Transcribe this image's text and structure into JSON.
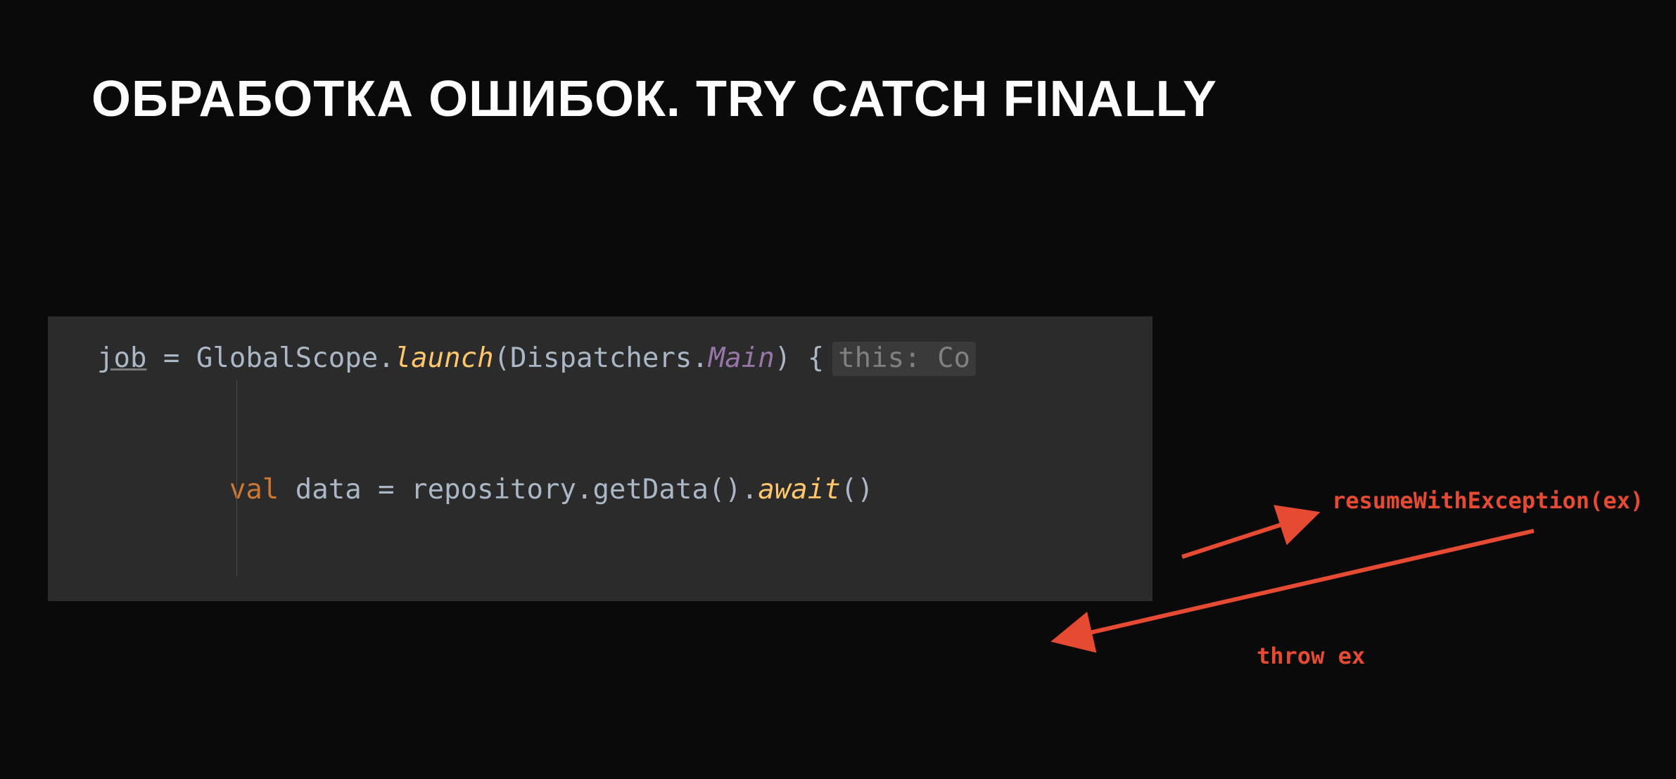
{
  "title": "ОБРАБОТКА ОШИБОК. TRY CATCH FINALLY",
  "code": {
    "line1": {
      "job": "job",
      "eq": " = ",
      "global": "GlobalScope",
      "dot1": ".",
      "launch": "launch",
      "lparen": "(",
      "dispatchers": "Dispatchers",
      "dot2": ".",
      "main": "Main",
      "rparen_brace": ") {",
      "hint": "this: Co"
    },
    "line2": {
      "indent": "        ",
      "val": "val",
      "sp1": " ",
      "data": "data",
      "eq": " = ",
      "repo": "repository",
      "dot1": ".",
      "getData": "getData",
      "parens1": "()",
      "dot2": ".",
      "await": "await",
      "parens2": "()"
    }
  },
  "annotations": {
    "a1": "resumeWithException(ex)",
    "a2": "throw ex"
  }
}
